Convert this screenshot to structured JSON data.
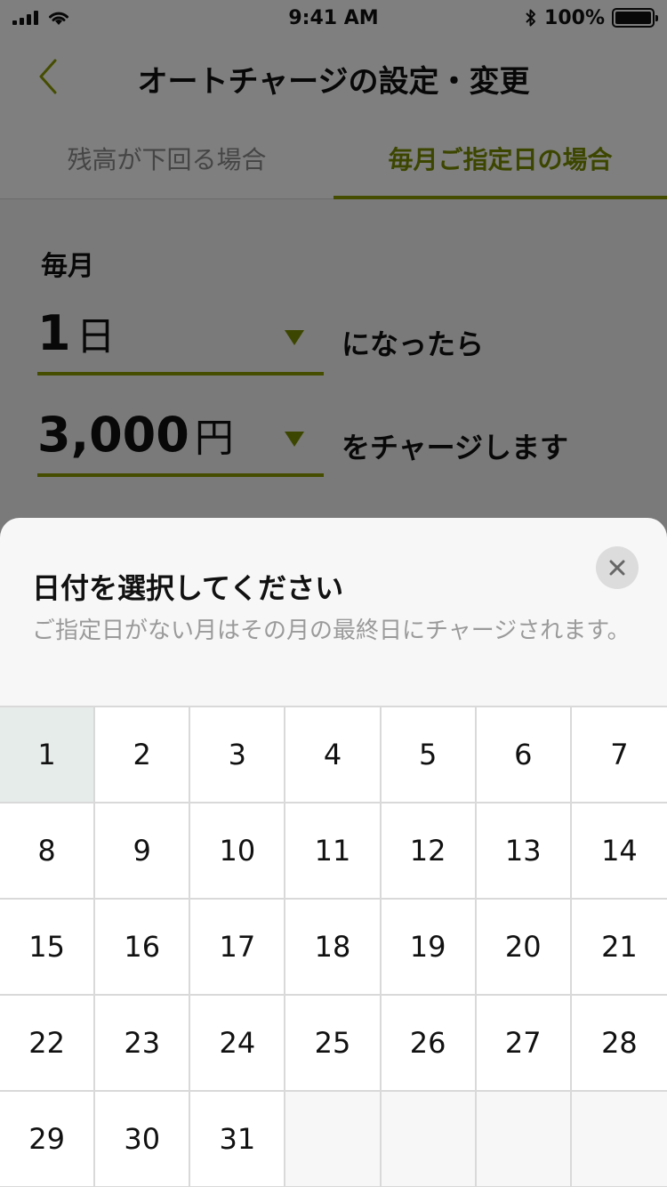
{
  "status_bar": {
    "time": "9:41 AM",
    "battery_percent": "100%",
    "battery_level": 1.0
  },
  "header": {
    "title": "オートチャージの設定・変更"
  },
  "tabs": [
    {
      "label": "残高が下回る場合",
      "active": false
    },
    {
      "label": "毎月ご指定日の場合",
      "active": true
    }
  ],
  "form": {
    "monthly_label": "毎月",
    "day_select": {
      "value": "1",
      "unit": "日"
    },
    "day_suffix": "になったら",
    "amount_select": {
      "value": "3,000",
      "unit": "円"
    },
    "amount_suffix": "をチャージします"
  },
  "sheet": {
    "title": "日付を選択してください",
    "note": "ご指定日がない月はその月の最終日にチャージされます。",
    "selected_day": 1,
    "days": [
      "1",
      "2",
      "3",
      "4",
      "5",
      "6",
      "7",
      "8",
      "9",
      "10",
      "11",
      "12",
      "13",
      "14",
      "15",
      "16",
      "17",
      "18",
      "19",
      "20",
      "21",
      "22",
      "23",
      "24",
      "25",
      "26",
      "27",
      "28",
      "29",
      "30",
      "31"
    ]
  },
  "colors": {
    "accent": "#8a9b00",
    "selected_cell": "#e6ece9"
  }
}
